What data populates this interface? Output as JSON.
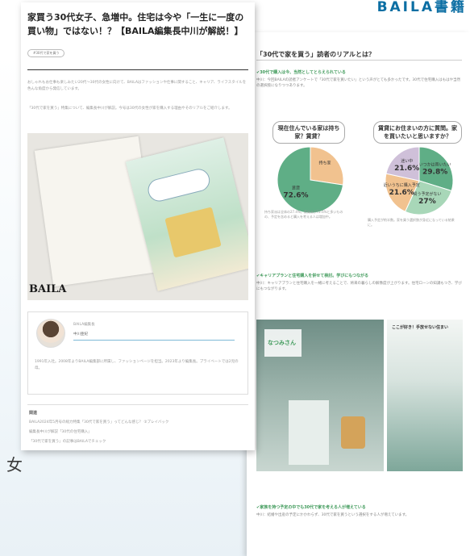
{
  "brand": {
    "top_right_word": "BAILA書籍",
    "left_wordmark": "女"
  },
  "card": {
    "title": "家買う30代女子、急増中。住宅は今や「一生に一度の買い物」ではない！？【BAILA編集長中川が解説！】",
    "tag": "#30代で家を買う",
    "paragraphs": [
      "おしゃれもお仕事も楽しみたい20代〜30代の女性に向けて、BAILAはファッションや仕事に関すること、キャリア、ライフスタイルを色んな角度から発信しています。",
      "「30代で家を買う」特集について、編集長中川が解説。今号は30代の女性が家を購入する理由やそのリアルをご紹介します。"
    ],
    "magazine_logo": "BAILA",
    "profile": {
      "name_label": "BAILA編集長",
      "name": "中川亜紀",
      "bio": "1991年入社。2008年よりBAILA編集部に所属し、ファッションページを担当。2023年より編集長。プライベートでは2児の母。"
    },
    "related": {
      "heading": "関連",
      "items": [
        "BAILA2024年5月号の総力特集「30代で家を買う」ってどんな感じ？ ②プレイバック",
        "編集長中川が解説「30代の住宅購入」",
        "「30代で家を買う」の記事はBAILAでチェック"
      ]
    }
  },
  "right": {
    "title": "「30代で家を買う」読者のリアルとは？",
    "subhead1": "✔30代で購入は今、当然としてとらえられている",
    "body1": "中川：今回BAILAの読者アンケートで「30代で家を買いたい」という声がとても多かったです。30代で住宅購入はもはや当然の選択肢になりつつあります。",
    "q1": "現在住んでいる家は持ち家？賃貸？",
    "q2": "賃貸にお住まいの方に質問。家を買いたいと思いますか？",
    "caption1": "持ち家派は全体の27.4%。賃貸派が72.6%と多いものの、予定を含めると購入を考える人は増加中。",
    "caption2": "購入予定が約半数。家を買う選択肢が身近になっている結果に。",
    "subhead2": "✔キャリアプランと住宅購入を併せて検討。学びにもつながる",
    "body2": "中川：キャリアプランと住宅購入を一緒に考えることで、将来の暮らしの解像度が上がります。住宅ローンの知識もつき、学びにもつながります。",
    "feature_title": "ここが好き！手放せない住まい",
    "photo_label": "なつみさん",
    "subhead3": "✔家族を持つ予定の中でも30代で家を考える人が増えている",
    "body3": "中川：結婚や出産の予定にかかわらず、30代で家を買うという選択をする人が増えています。"
  },
  "chart_data": [
    {
      "type": "pie",
      "title": "現在住んでいる家は持ち家？賃貸？",
      "categories": [
        "持ち家",
        "賃貸"
      ],
      "values": [
        27.4,
        72.6
      ],
      "labels": [
        "",
        "72.6%"
      ],
      "colors": [
        "#f1c28f",
        "#5fae86"
      ]
    },
    {
      "type": "pie",
      "title": "賃貸にお住まいの方に質問。家を買いたいと思いますか？",
      "categories": [
        "いつかは買いたい",
        "買う予定がない",
        "近いうちに購入予定",
        "迷い中"
      ],
      "values": [
        29.8,
        27.0,
        21.6,
        21.6
      ],
      "labels": [
        "29.8%",
        "27%",
        "21.6%",
        "21.6%"
      ],
      "colors": [
        "#5fae86",
        "#a8d7b8",
        "#f1c28f",
        "#cfc0d9"
      ]
    }
  ]
}
